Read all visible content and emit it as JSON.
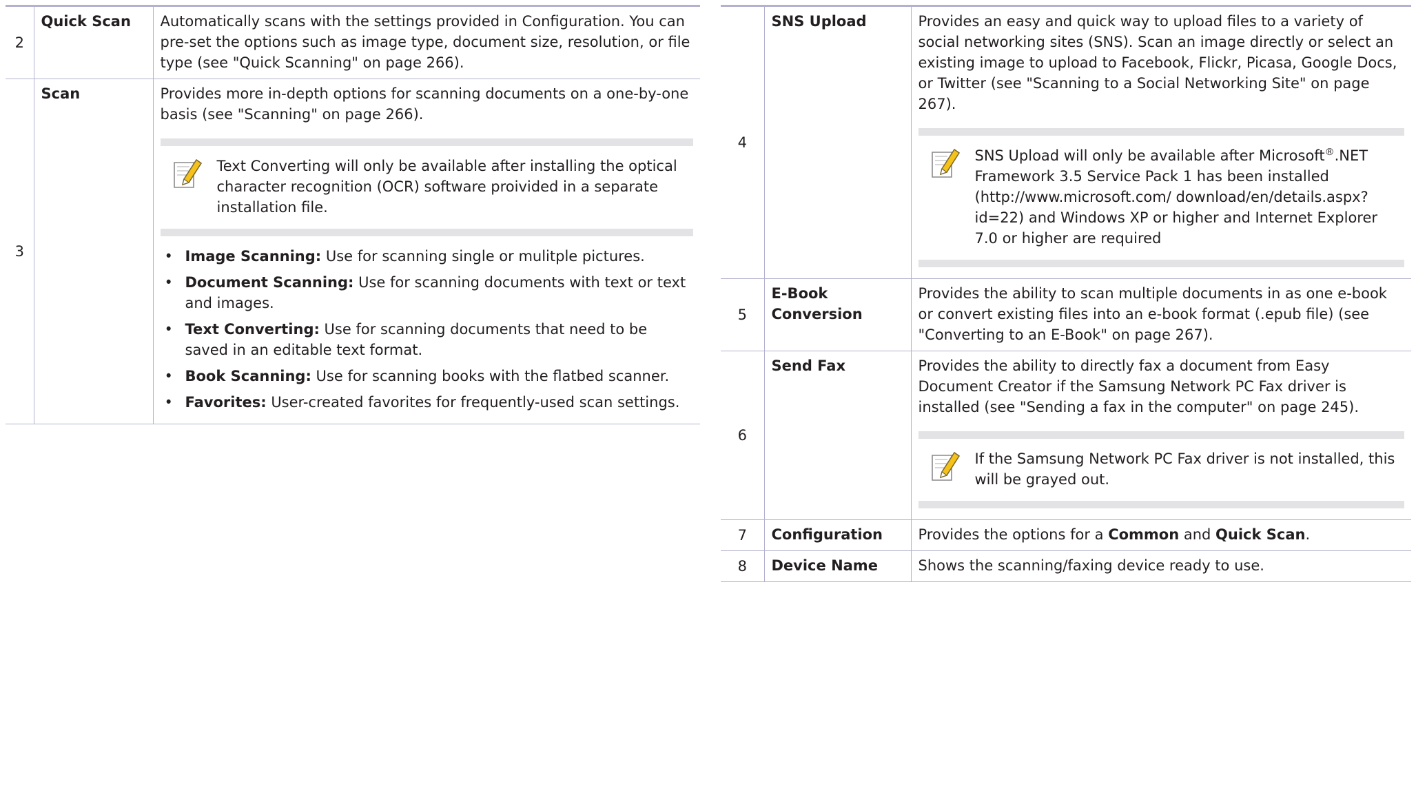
{
  "left_table": {
    "rows": [
      {
        "num": "2",
        "title": "Quick Scan",
        "desc": "Automatically scans with the settings provided in Configuration. You can pre-set the options such as image type, document size, resolution, or file type (see \"Quick Scanning\" on page 266)."
      },
      {
        "num": "3",
        "title": "Scan",
        "desc": "Provides more in-depth options for scanning documents on a one-by-one basis (see \"Scanning\" on page 266).",
        "note": "Text Converting will only be available after installing the optical character recognition (OCR) software proivided in a separate installation file.",
        "bullets": [
          {
            "label": "Image Scanning:",
            "text": " Use for scanning single or mulitple pictures."
          },
          {
            "label": "Document Scanning:",
            "text": " Use for scanning documents with text or text and images."
          },
          {
            "label": "Text Converting:",
            "text": "  Use for scanning documents that need to be saved in an editable text format."
          },
          {
            "label": "Book Scanning:",
            "text": "  Use for scanning books with the flatbed scanner."
          },
          {
            "label": "Favorites:",
            "text": "  User-created favorites for frequently-used scan settings."
          }
        ]
      }
    ]
  },
  "right_table": {
    "rows": [
      {
        "num": "4",
        "title": "SNS Upload",
        "desc": "Provides an easy and quick way to upload files to a variety of social networking sites (SNS). Scan an image directly or select an existing image to upload to Facebook, Flickr, Picasa, Google Docs, or Twitter (see \"Scanning to a Social Networking Site\" on page 267).",
        "note_pre": "SNS Upload will only be available after Microsoft",
        "note_sup": "®",
        "note_post": ".NET Framework 3.5 Service Pack 1 has been installed (http://www.microsoft.com/ download/en/details.aspx?id=22) and Windows XP or higher and Internet Explorer 7.0 or higher are required"
      },
      {
        "num": "5",
        "title": "E-Book Conversion",
        "desc": "Provides the ability to scan multiple documents in as one e-book or convert existing files into an e-book format (.epub file) (see \"Converting to an E-Book\" on page 267)."
      },
      {
        "num": "6",
        "title": "Send Fax",
        "desc": "Provides the ability to directly fax a document from Easy Document Creator if the Samsung Network PC Fax driver is installed (see \"Sending a fax in the computer\" on page 245).",
        "note": "If the Samsung Network PC Fax driver is not installed, this will be grayed out."
      },
      {
        "num": "7",
        "title": "Configuration",
        "desc_pre": "Provides the options for a ",
        "desc_b1": "Common",
        "desc_mid": " and ",
        "desc_b2": "Quick Scan",
        "desc_post": "."
      },
      {
        "num": "8",
        "title": "Device Name",
        "desc": "Shows the scanning/faxing device ready to use."
      }
    ]
  },
  "note_icon": "pencil-note-icon",
  "colors": {
    "rule": "#b3b1cf",
    "note_band": "#e3e3e5",
    "pencil": "#f5c21b"
  }
}
